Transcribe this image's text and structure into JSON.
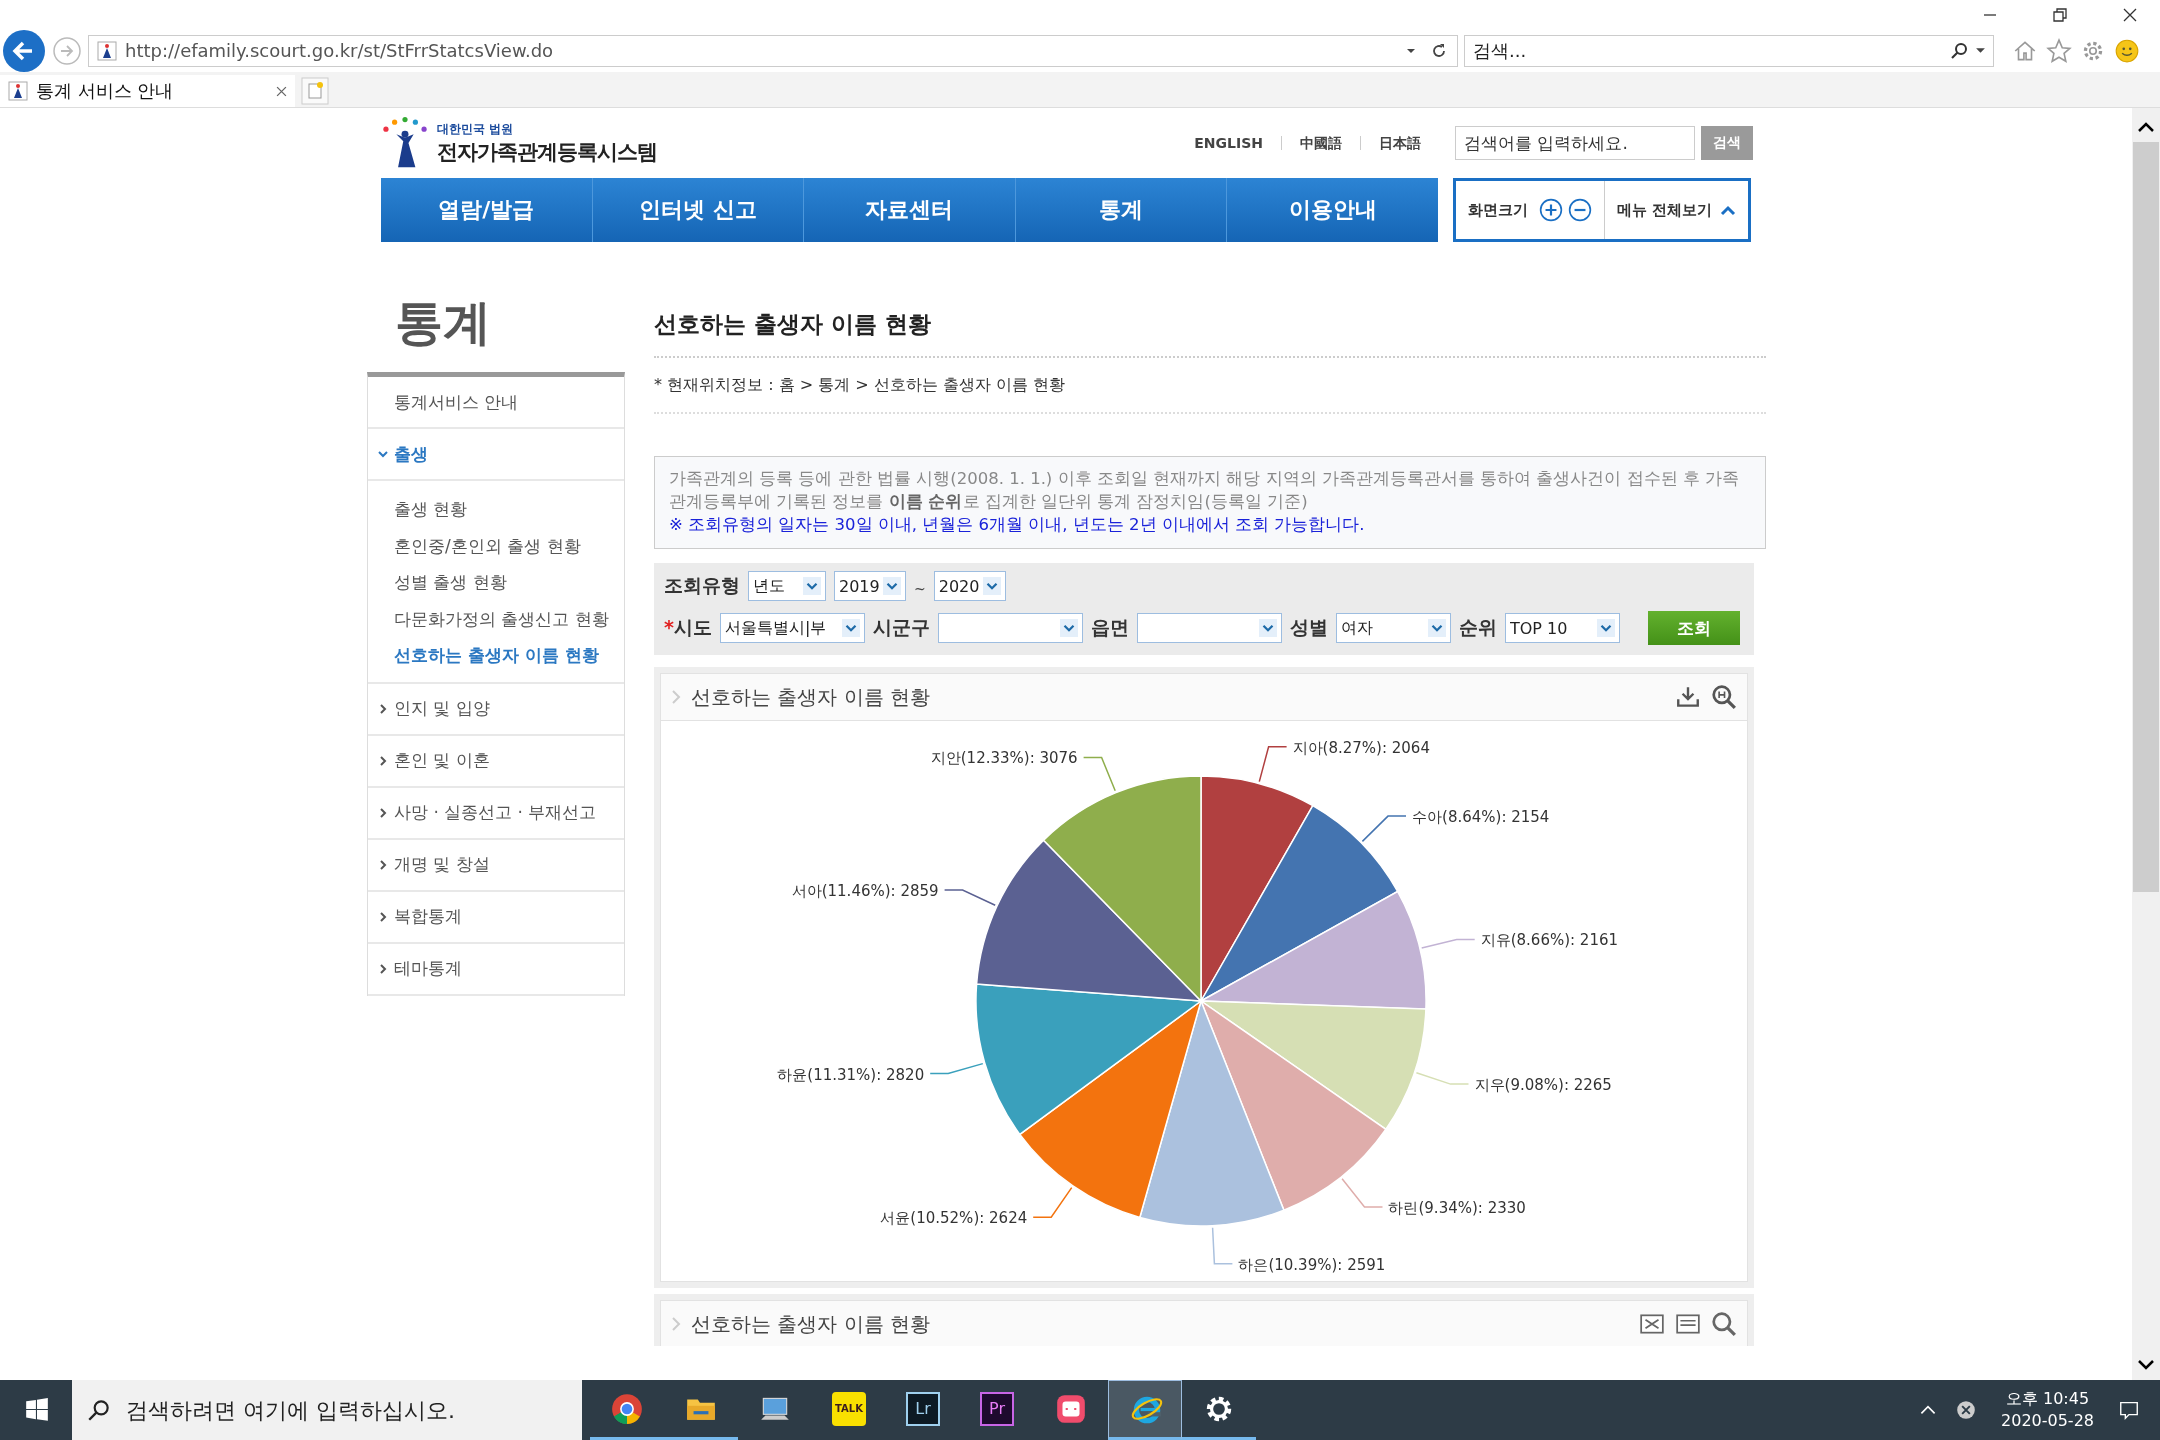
{
  "browser": {
    "url": "http://efamily.scourt.go.kr/st/StFrrStatcsView.do",
    "search": {
      "placeholder": "검색..."
    },
    "tabs": [
      {
        "title": "통계 서비스 안내",
        "selected": true
      }
    ]
  },
  "header": {
    "logo": {
      "subtitle": "대한민국 법원",
      "title": "전자가족관계등록시스템"
    },
    "languages": [
      "ENGLISH",
      "中國語",
      "日本語"
    ],
    "search": {
      "placeholder": "검색어를 입력하세요.",
      "button": "검색"
    },
    "nav": [
      {
        "label": "열람/발급"
      },
      {
        "label": "인터넷 신고"
      },
      {
        "label": "자료센터"
      },
      {
        "label": "통계"
      },
      {
        "label": "이용안내"
      }
    ],
    "tools": {
      "zoom_label": "화면크기",
      "menu_label": "메뉴 전체보기"
    }
  },
  "sidebar": {
    "title": "통계",
    "items": [
      {
        "label": "통계서비스 안내",
        "kind": "link",
        "selected": false
      },
      {
        "label": "출생",
        "kind": "group",
        "expanded": true,
        "selected": true,
        "children": [
          {
            "label": "출생 현황",
            "selected": false
          },
          {
            "label": "혼인중/혼인외 출생 현황",
            "selected": false
          },
          {
            "label": "성별 출생 현황",
            "selected": false
          },
          {
            "label": "다문화가정의 출생신고 현황",
            "selected": false
          },
          {
            "label": "선호하는 출생자 이름 현황",
            "selected": true
          }
        ]
      },
      {
        "label": "인지 및 입양",
        "kind": "group",
        "expanded": false,
        "selected": false
      },
      {
        "label": "혼인 및 이혼",
        "kind": "group",
        "expanded": false,
        "selected": false
      },
      {
        "label": "사망 · 실종선고 · 부재선고",
        "kind": "group",
        "expanded": false,
        "selected": false
      },
      {
        "label": "개명 및 창설",
        "kind": "group",
        "expanded": false,
        "selected": false
      },
      {
        "label": "복합통계",
        "kind": "group",
        "expanded": false,
        "selected": false
      },
      {
        "label": "테마통계",
        "kind": "group",
        "expanded": false,
        "selected": false
      }
    ]
  },
  "main": {
    "title": "선호하는 출생자 이름 현황",
    "breadcrumb": "* 현재위치정보 : 홈 > 통계 > 선호하는 출생자 이름 현황",
    "notice": {
      "text": "가족관계의 등록 등에 관한 법률 시행(2008. 1. 1.) 이후 조회일 현재까지 해당 지역의 가족관계등록관서를 통하여 출생사건이 접수된 후 가족관계등록부에 기록된 정보를 **이름 순위**로 집계한 일단위 통계 잠정치임(등록일 기준)",
      "note": "※ 조회유형의 일자는 30일 이내, 년월은 6개월 이내, 년도는 2년 이내에서 조회 가능합니다."
    },
    "filters": {
      "period": {
        "label": "조회유형",
        "type": "년도",
        "from": "2019",
        "separator": "~",
        "to": "2020"
      },
      "required_mark": "*",
      "fields": [
        {
          "label": "시도",
          "required": true,
          "value": "서울특별시|부"
        },
        {
          "label": "시군구",
          "required": false
        },
        {
          "label": "읍면",
          "required": false
        },
        {
          "label": "성별",
          "required": false,
          "value": "여자"
        },
        {
          "label": "순위",
          "required": false,
          "value": "TOP 10"
        }
      ],
      "button": "조회"
    },
    "panels": [
      {
        "kind": "chart",
        "title": "선호하는 출생자 이름 현황",
        "chart_data": {
          "type": "pie",
          "categories": [
            "지아(8.27%): 2064",
            "수아(8.64%): 2154",
            "지유(8.66%): 2161",
            "지우(9.08%): 2265",
            "하린(9.34%): 2330",
            "하은(10.39%): 2591",
            "서윤(10.52%): 2624",
            "하윤(11.31%): 2820",
            "서아(11.46%): 2859",
            "지안(12.33%): 3076"
          ],
          "series": [
            {
              "values": [
                2064,
                2154,
                2161,
                2265,
                2330,
                2591,
                2624,
                2820,
                2859,
                3076
              ]
            }
          ],
          "colors": [
            "#b14040",
            "#4474b0",
            "#c2b3d4",
            "#d6dfb4",
            "#dfadab",
            "#abc1de",
            "#f3730e",
            "#3aa0bc",
            "#5b6192",
            "#8fae4c"
          ]
        }
      },
      {
        "kind": "table",
        "title": "선호하는 출생자 이름 현황"
      }
    ]
  },
  "taskbar": {
    "search": {
      "placeholder": "검색하려면 여기에 입력하십시오."
    },
    "apps": [
      {
        "kind": "chrome",
        "running": true,
        "selected": false
      },
      {
        "kind": "folder",
        "running": true,
        "selected": false
      },
      {
        "kind": "computer",
        "running": false,
        "selected": false
      },
      {
        "kind": "talk",
        "label": "TALK",
        "running": false,
        "selected": false
      },
      {
        "kind": "lr",
        "label": "Lr",
        "running": false,
        "selected": false
      },
      {
        "kind": "pr",
        "label": "Pr",
        "running": false,
        "selected": false
      },
      {
        "kind": "pink",
        "running": false,
        "selected": false
      },
      {
        "kind": "ie",
        "running": true,
        "selected": true
      },
      {
        "kind": "gear",
        "running": true,
        "selected": false
      }
    ],
    "clock": {
      "time": "오후 10:45",
      "date": "2020-05-28"
    }
  }
}
